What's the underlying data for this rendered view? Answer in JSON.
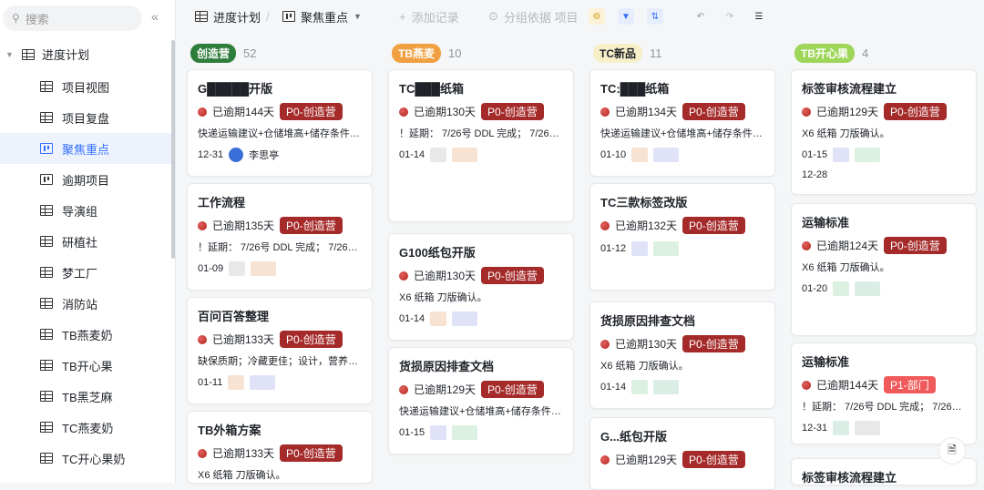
{
  "sidebar": {
    "search_placeholder": "搜索",
    "project": "进度计划",
    "items": [
      {
        "label": "项目视图",
        "icon": "grid"
      },
      {
        "label": "项目复盘",
        "icon": "grid"
      },
      {
        "label": "聚焦重点",
        "icon": "kanban",
        "active": true
      },
      {
        "label": "逾期项目",
        "icon": "kanban"
      },
      {
        "label": "导演组",
        "icon": "grid"
      },
      {
        "label": "研植社",
        "icon": "grid"
      },
      {
        "label": "梦工厂",
        "icon": "grid"
      },
      {
        "label": "消防站",
        "icon": "grid"
      },
      {
        "label": "TB燕麦奶",
        "icon": "grid"
      },
      {
        "label": "TB开心果",
        "icon": "grid"
      },
      {
        "label": "TB黑芝麻",
        "icon": "grid"
      },
      {
        "label": "TC燕麦奶",
        "icon": "grid"
      },
      {
        "label": "TC开心果奶",
        "icon": "grid"
      }
    ]
  },
  "toolbar": {
    "table_name": "进度计划",
    "view_name": "聚焦重点",
    "add_record": "添加记录",
    "group_by": "分组依据 项目"
  },
  "columns": [
    {
      "tag": "创造营",
      "count": "52",
      "tag_bg": "#2f7d3a",
      "tag_fg": "#ffffff",
      "cards": [
        {
          "title": "G█████开版",
          "overdue": "已逾期144天",
          "priority": "P0-创造营",
          "desc": "快递运输建议+仓储堆高+储存条件+...",
          "date": "12-31",
          "person": "李思亭"
        },
        {
          "title": "工作流程",
          "overdue": "已逾期135天",
          "priority": "P0-创造营",
          "desc": "！延期： 7/26号 DDL 完成； 7/26签...",
          "date": "01-09",
          "person": ""
        },
        {
          "title": "百问百答整理",
          "overdue": "已逾期133天",
          "priority": "P0-创造营",
          "desc": "缺保质期；冷藏更佳；设计，营养成...",
          "date": "01-11",
          "person": ""
        },
        {
          "title": "TB外箱方案",
          "overdue": "已逾期133天",
          "priority": "P0-创造营",
          "desc": "X6 纸箱 刀版确认。",
          "date": "",
          "person": ""
        }
      ]
    },
    {
      "tag": "TB燕麦",
      "count": "10",
      "tag_bg": "#f0a040",
      "tag_fg": "#ffffff",
      "cards": [
        {
          "title": "TC███纸箱",
          "overdue": "已逾期130天",
          "priority": "P0-创造营",
          "desc": "！延期： 7/26号 DDL 完成； 7/26签...",
          "date": "01-14",
          "person": ""
        },
        {
          "title": "G100纸包开版",
          "overdue": "已逾期130天",
          "priority": "P0-创造营",
          "desc": "X6 纸箱 刀版确认。",
          "date": "01-14",
          "person": ""
        },
        {
          "title": "货损原因排查文档",
          "overdue": "已逾期129天",
          "priority": "P0-创造营",
          "desc": "快递运输建议+仓储堆高+储存条件+...",
          "date": "01-15",
          "person": ""
        }
      ]
    },
    {
      "tag": "TC新品",
      "count": "11",
      "tag_bg": "#f7efc8",
      "tag_fg": "#1f2329",
      "cards": [
        {
          "title": "TC:███纸箱",
          "overdue": "已逾期134天",
          "priority": "P0-创造营",
          "desc": "快递运输建议+仓储堆高+储存条件+...",
          "date": "01-10",
          "person": ""
        },
        {
          "title": "TC三款标签改版",
          "overdue": "已逾期132天",
          "priority": "P0-创造营",
          "desc": "",
          "date": "01-12",
          "person": ""
        },
        {
          "title": "货损原因排查文档",
          "overdue": "已逾期130天",
          "priority": "P0-创造营",
          "desc": "X6 纸箱 刀版确认。",
          "date": "01-14",
          "person": ""
        },
        {
          "title": "G...纸包开版",
          "overdue": "已逾期129天",
          "priority": "P0-创造营",
          "desc": "",
          "date": "",
          "person": ""
        }
      ]
    },
    {
      "tag": "TB开心果",
      "count": "4",
      "tag_bg": "#9ed65a",
      "tag_fg": "#ffffff",
      "cards": [
        {
          "title": "标签审核流程建立",
          "overdue": "已逾期129天",
          "priority": "P0-创造营",
          "desc": "X6 纸箱 刀版确认。",
          "date": "01-15",
          "date2": "12-28",
          "person": ""
        },
        {
          "title": "运输标准",
          "overdue": "已逾期124天",
          "priority": "P0-创造营",
          "desc": "X6 纸箱 刀版确认。",
          "date": "01-20",
          "person": ""
        },
        {
          "title": "运输标准",
          "overdue": "已逾期144天",
          "priority": "P1-部门",
          "desc": "！延期： 7/26号 DDL 完成； 7/26签...",
          "date": "12-31",
          "person": ""
        },
        {
          "title": "标签审核流程建立",
          "overdue": "",
          "priority": "",
          "desc": "",
          "date": "",
          "person": ""
        }
      ]
    }
  ]
}
